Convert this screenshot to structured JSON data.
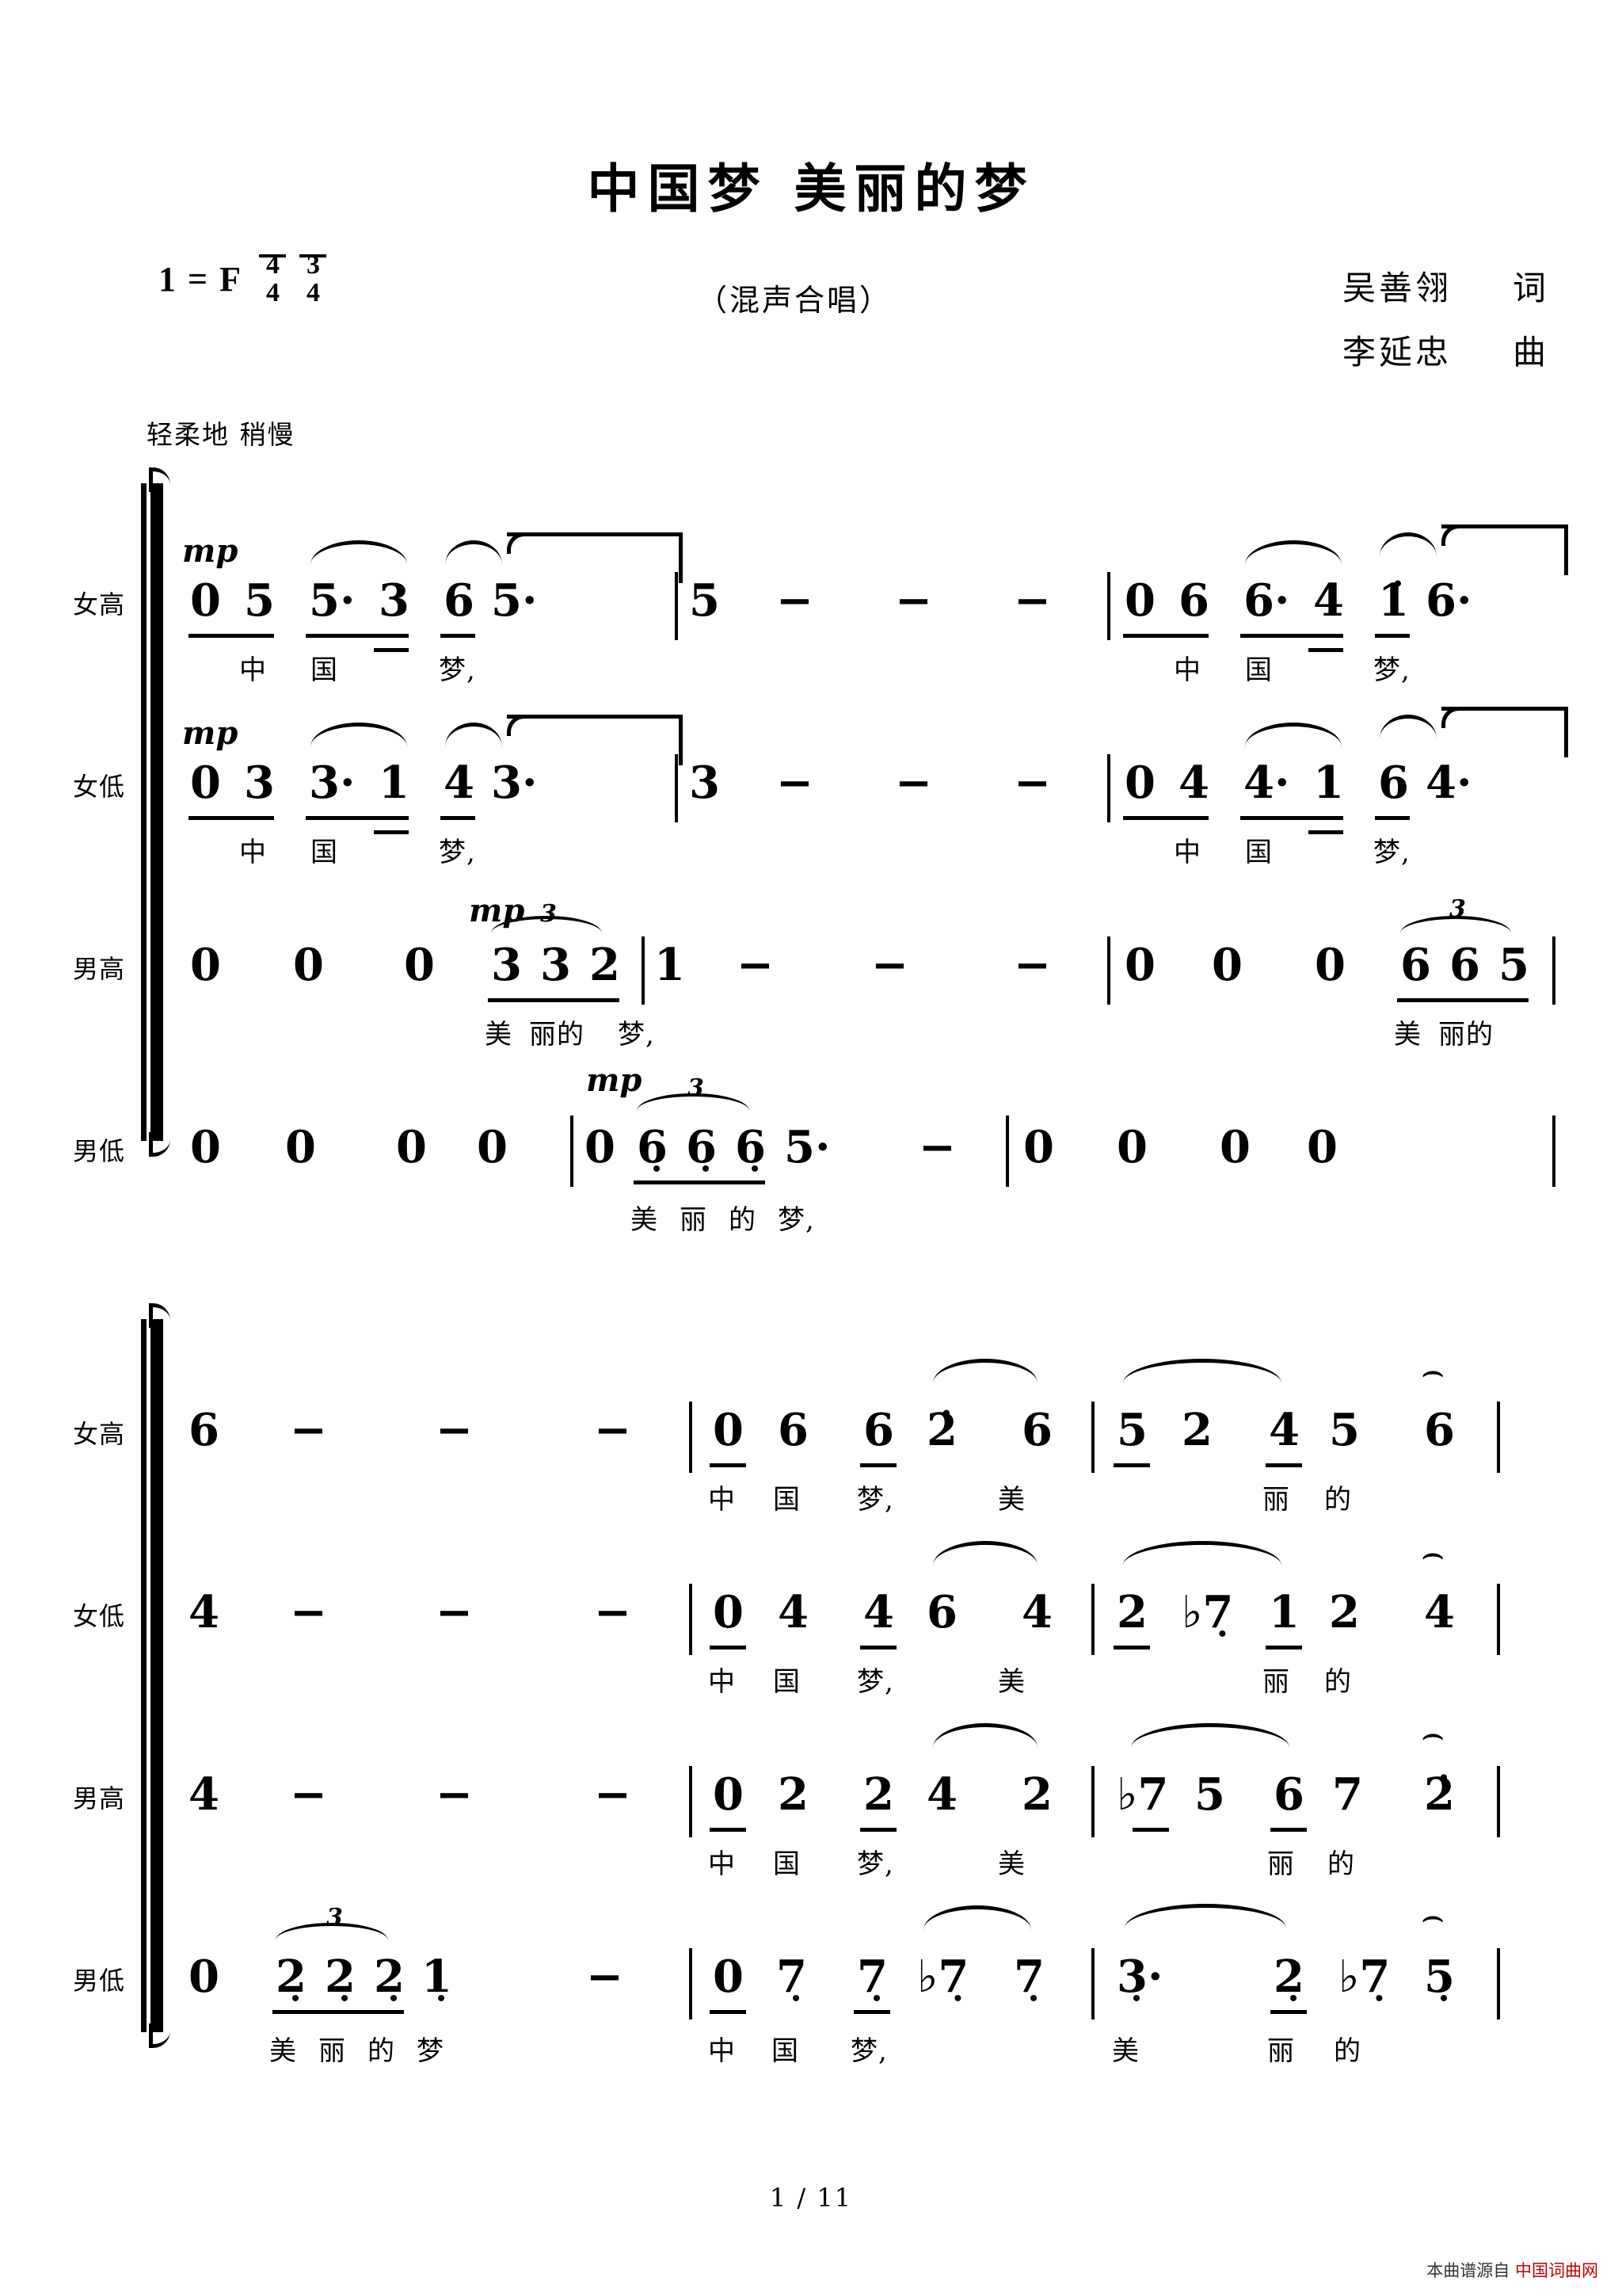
{
  "header": {
    "title": "中国梦  美丽的梦",
    "subtitle": "（混声合唱）",
    "key_label": "1 = F",
    "time_signatures": [
      {
        "num": "4",
        "den": "4"
      },
      {
        "num": "3",
        "den": "4"
      }
    ],
    "lyricist": "吴善翎",
    "lyricist_role": "词",
    "composer": "李延忠",
    "composer_role": "曲",
    "tempo": "轻柔地 稍慢"
  },
  "footer": {
    "page": "1 / 11",
    "watermark_prefix": "本曲谱源自",
    "watermark_site": "中国词曲网"
  },
  "voices": {
    "soprano": "女高",
    "alto": "女低",
    "tenor": "男高",
    "bass": "男低"
  },
  "dynamics": {
    "mp": "mp"
  },
  "symbols": {
    "rest": "0",
    "dash": "−",
    "triplet": "3",
    "flat": "♭",
    "fermata": "⌢"
  },
  "chart_data": {
    "type": "table",
    "title": "中国梦  美丽的梦 — 简谱 (numbered musical notation), 混声合唱",
    "key": "1 = F",
    "meter": "4/4  3/4",
    "tempo": "轻柔地 稍慢",
    "systems": [
      {
        "index": 1,
        "parts": [
          {
            "voice": "女高",
            "dynamic": "mp",
            "measures": [
              {
                "notes": [
                  "0",
                  "5",
                  "5·",
                  "3",
                  "6",
                  "5·"
                ],
                "lyrics": [
                  "",
                  "",
                  "中",
                  "国",
                  "梦,",
                  ""
                ]
              },
              {
                "notes": [
                  "5",
                  "−",
                  "−",
                  "−"
                ],
                "lyrics": []
              },
              {
                "notes": [
                  "0",
                  "6",
                  "6·",
                  "4",
                  "1̇",
                  "6·"
                ],
                "lyrics": [
                  "",
                  "",
                  "中",
                  "国",
                  "梦,",
                  ""
                ]
              }
            ]
          },
          {
            "voice": "女低",
            "dynamic": "mp",
            "measures": [
              {
                "notes": [
                  "0",
                  "3",
                  "3·",
                  "1",
                  "4",
                  "3·"
                ],
                "lyrics": [
                  "",
                  "",
                  "中",
                  "国",
                  "梦,",
                  ""
                ]
              },
              {
                "notes": [
                  "3",
                  "−",
                  "−",
                  "−"
                ],
                "lyrics": []
              },
              {
                "notes": [
                  "0",
                  "4",
                  "4·",
                  "1",
                  "6",
                  "4·"
                ],
                "lyrics": [
                  "",
                  "",
                  "中",
                  "国",
                  "梦,",
                  ""
                ]
              }
            ]
          },
          {
            "voice": "男高",
            "dynamic": "mp",
            "measures": [
              {
                "notes": [
                  "0",
                  "0",
                  "0",
                  "3",
                  "3",
                  "2"
                ],
                "triplet": true,
                "lyrics": [
                  "",
                  "",
                  "",
                  "美",
                  "丽的",
                  "梦,"
                ]
              },
              {
                "notes": [
                  "1",
                  "−",
                  "−",
                  "−"
                ],
                "lyrics": []
              },
              {
                "notes": [
                  "0",
                  "0",
                  "0",
                  "6",
                  "6",
                  "5"
                ],
                "triplet": true,
                "lyrics": [
                  "",
                  "",
                  "",
                  "美",
                  "丽的",
                  ""
                ]
              }
            ]
          },
          {
            "voice": "男低",
            "dynamic": "mp",
            "measures": [
              {
                "notes": [
                  "0",
                  "0",
                  "0",
                  "0"
                ],
                "lyrics": []
              },
              {
                "notes": [
                  "0",
                  "6̣",
                  "6̣",
                  "6̣",
                  "5·"
                ],
                "triplet": true,
                "lyrics": [
                  "",
                  "美",
                  "丽",
                  "的",
                  "梦,"
                ]
              },
              {
                "notes": [
                  "−"
                ],
                "lyrics": []
              },
              {
                "notes": [
                  "0",
                  "0",
                  "0",
                  "0"
                ],
                "lyrics": []
              }
            ]
          }
        ]
      },
      {
        "index": 2,
        "parts": [
          {
            "voice": "女高",
            "measures": [
              {
                "notes": [
                  "6",
                  "−",
                  "−",
                  "−"
                ],
                "lyrics": []
              },
              {
                "notes": [
                  "0",
                  "6",
                  "6",
                  "2̇",
                  "6"
                ],
                "lyrics": [
                  "",
                  "中",
                  "国",
                  "梦,",
                  "美"
                ]
              },
              {
                "notes": [
                  "5",
                  "2",
                  "4",
                  "5",
                  "6"
                ],
                "fermata_last": true,
                "lyrics": [
                  "",
                  "",
                  "丽",
                  "的",
                  ""
                ]
              }
            ]
          },
          {
            "voice": "女低",
            "measures": [
              {
                "notes": [
                  "4",
                  "−",
                  "−",
                  "−"
                ],
                "lyrics": []
              },
              {
                "notes": [
                  "0",
                  "4",
                  "4",
                  "6",
                  "4"
                ],
                "lyrics": [
                  "",
                  "中",
                  "国",
                  "梦,",
                  "美"
                ]
              },
              {
                "notes": [
                  "2",
                  "♭7̣",
                  "1",
                  "2",
                  "4"
                ],
                "fermata_last": true,
                "lyrics": [
                  "",
                  "",
                  "丽",
                  "的",
                  ""
                ]
              }
            ]
          },
          {
            "voice": "男高",
            "measures": [
              {
                "notes": [
                  "4",
                  "−",
                  "−",
                  "−"
                ],
                "lyrics": []
              },
              {
                "notes": [
                  "0",
                  "2",
                  "2",
                  "4",
                  "2"
                ],
                "lyrics": [
                  "",
                  "中",
                  "国",
                  "梦,",
                  "美"
                ]
              },
              {
                "notes": [
                  "♭7",
                  "5",
                  "6",
                  "7",
                  "2̇"
                ],
                "fermata_last": true,
                "lyrics": [
                  "",
                  "",
                  "丽",
                  "的",
                  ""
                ]
              }
            ]
          },
          {
            "voice": "男低",
            "measures": [
              {
                "notes": [
                  "0",
                  "2̣",
                  "2̣",
                  "2̣",
                  "1̣"
                ],
                "triplet": true,
                "lyrics": [
                  "",
                  "美",
                  "丽",
                  "的",
                  "梦"
                ]
              },
              {
                "notes": [
                  "−"
                ],
                "lyrics": []
              },
              {
                "notes": [
                  "0",
                  "7̣",
                  "7̣",
                  "♭7̣",
                  "7̣"
                ],
                "lyrics": [
                  "",
                  "中",
                  "国",
                  "梦,",
                  ""
                ]
              },
              {
                "notes": [
                  "3̣·",
                  "2̣",
                  "♭7̣",
                  "5̣"
                ],
                "fermata_last": true,
                "lyrics": [
                  "美",
                  "",
                  "丽",
                  "的"
                ]
              }
            ]
          }
        ]
      }
    ]
  }
}
